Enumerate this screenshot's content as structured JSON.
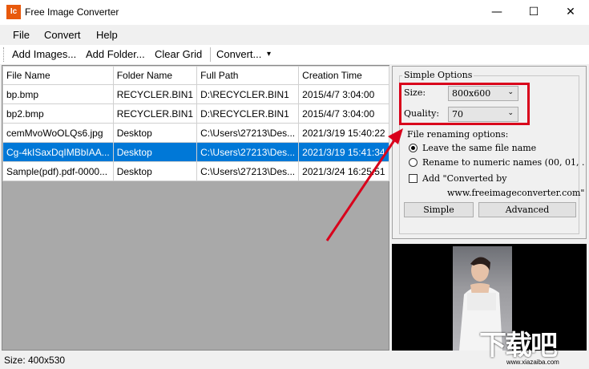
{
  "window": {
    "title": "Free Image Converter",
    "icon_text": "Ic",
    "minimize": "—",
    "maximize": "☐",
    "close": "✕"
  },
  "menu": [
    {
      "label": "File"
    },
    {
      "label": "Convert"
    },
    {
      "label": "Help"
    }
  ],
  "toolbar": {
    "add_images": "Add Images...",
    "add_folder": "Add Folder...",
    "clear_grid": "Clear Grid",
    "convert": "Convert...",
    "dropdown": "▾"
  },
  "grid": {
    "columns": [
      "File Name",
      "Folder Name",
      "Full Path",
      "Creation Time"
    ],
    "rows": [
      [
        "bp.bmp",
        "RECYCLER.BIN1",
        "D:\\RECYCLER.BIN1",
        "2015/4/7 3:04:00"
      ],
      [
        "bp2.bmp",
        "RECYCLER.BIN1",
        "D:\\RECYCLER.BIN1",
        "2015/4/7 3:04:00"
      ],
      [
        "cemMvoWoOLQs6.jpg",
        "Desktop",
        "C:\\Users\\27213\\Des...",
        "2021/3/19 15:40:22"
      ],
      [
        "Cg-4kISaxDqIMBbIAA...",
        "Desktop",
        "C:\\Users\\27213\\Des...",
        "2021/3/19 15:41:34"
      ],
      [
        "Sample(pdf).pdf-0000...",
        "Desktop",
        "C:\\Users\\27213\\Des...",
        "2021/3/24 16:25:51"
      ]
    ],
    "selected_row": 3
  },
  "options": {
    "legend": "Simple Options",
    "size_label": "Size:",
    "size_value": "800x600",
    "quality_label": "Quality:",
    "quality_value": "70",
    "renaming_label": "File renaming options:",
    "radio_same": "Leave the same file name",
    "radio_numeric": "Rename to numeric names (00, 01, .",
    "add_converted": "Add \"Converted by",
    "add_converted_url": "www.freeimageconverter.com\"",
    "simple_button": "Simple",
    "advanced_button": "Advanced"
  },
  "status": {
    "text": "Size: 400x530"
  },
  "watermark": {
    "text": "下载吧",
    "url": "www.xiazaiba.com"
  },
  "colors": {
    "selection": "#0078d7",
    "annotation_red": "#d9001b",
    "app_icon": "#e8590c"
  },
  "icons": {
    "app": "app-icon",
    "chevron": "chevron-down-icon"
  }
}
